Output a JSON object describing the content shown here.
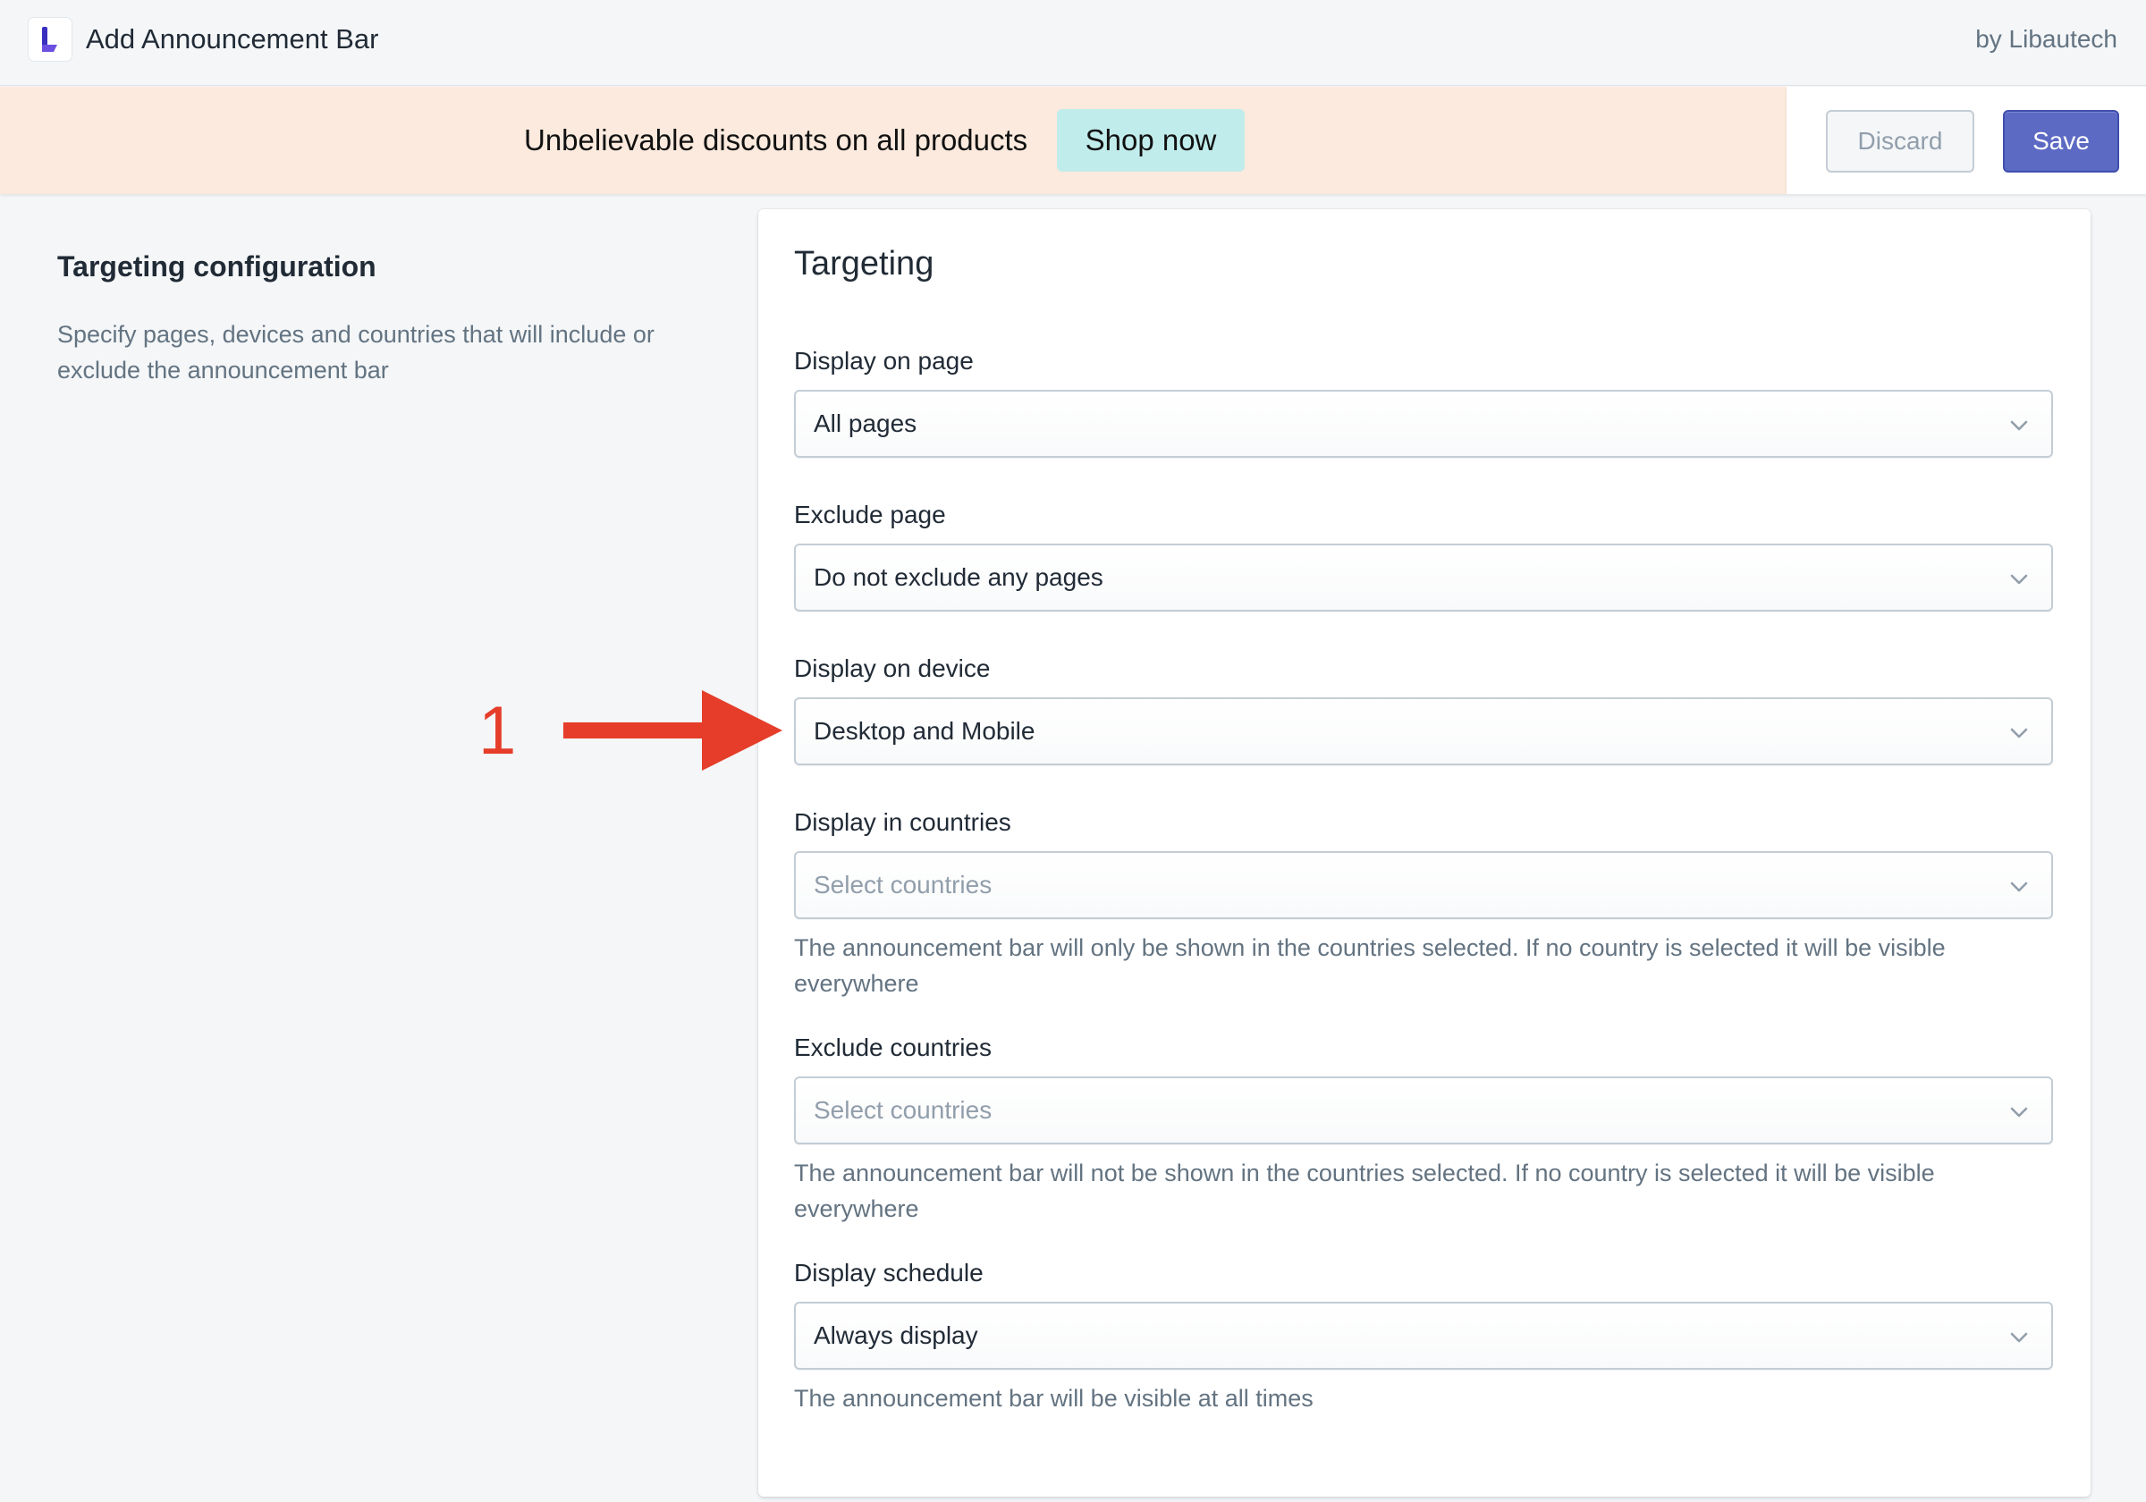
{
  "header": {
    "app_title": "Add Announcement Bar",
    "by_line": "by Libautech",
    "logo_icon": "libautech-logo-icon"
  },
  "preview": {
    "message": "Unbelievable discounts on all products",
    "button_label": "Shop now",
    "background_color": "#fbeadd",
    "button_color": "#c1ecec"
  },
  "actions": {
    "discard_label": "Discard",
    "save_label": "Save",
    "save_color": "#5c6ac4"
  },
  "sidebar": {
    "heading": "Targeting configuration",
    "description": "Specify pages, devices and countries that will include or exclude the announcement bar"
  },
  "card": {
    "title": "Targeting",
    "fields": [
      {
        "label": "Display on page",
        "value": "All pages",
        "placeholder": false,
        "help": ""
      },
      {
        "label": "Exclude page",
        "value": "Do not exclude any pages",
        "placeholder": false,
        "help": ""
      },
      {
        "label": "Display on device",
        "value": "Desktop and Mobile",
        "placeholder": false,
        "help": ""
      },
      {
        "label": "Display in countries",
        "value": "Select countries",
        "placeholder": true,
        "help": "The announcement bar will only be shown in the countries selected. If no country is selected it will be visible everywhere"
      },
      {
        "label": "Exclude countries",
        "value": "Select countries",
        "placeholder": true,
        "help": "The announcement bar will not be shown in the countries selected. If no country is selected it will be visible everywhere"
      },
      {
        "label": "Display schedule",
        "value": "Always display",
        "placeholder": false,
        "help": "The announcement bar will be visible at all times"
      }
    ]
  },
  "annotation": {
    "number": "1",
    "color": "#e53d2a"
  }
}
